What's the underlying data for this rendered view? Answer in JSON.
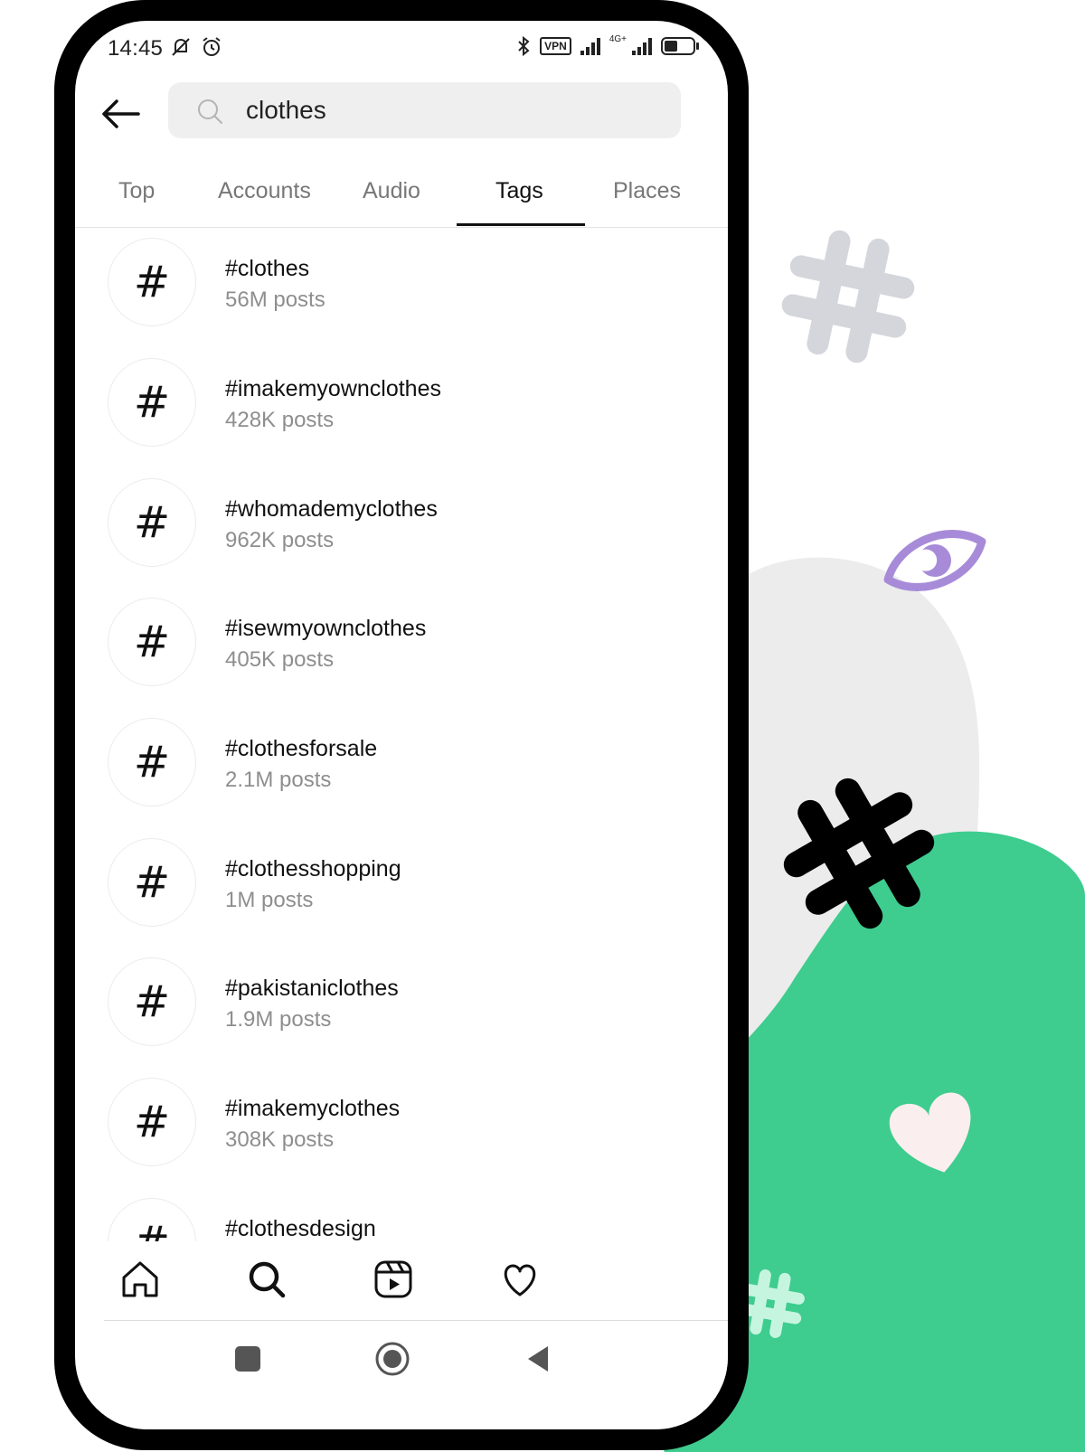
{
  "statusbar": {
    "time": "14:45",
    "icons": [
      "mute-icon",
      "alarm-icon",
      "bluetooth-icon",
      "vpn-icon",
      "signal-icon",
      "signal-4g-icon",
      "battery-icon"
    ],
    "vpn": "VPN",
    "network": "4G+"
  },
  "search": {
    "query": "clothes",
    "back_icon": "back-arrow-icon",
    "search_icon": "search-icon"
  },
  "tabs": [
    {
      "label": "Top",
      "active": false
    },
    {
      "label": "Accounts",
      "active": false
    },
    {
      "label": "Audio",
      "active": false
    },
    {
      "label": "Tags",
      "active": true
    },
    {
      "label": "Places",
      "active": false
    }
  ],
  "tag_symbol": "#",
  "results": [
    {
      "name": "#clothes",
      "count": "56M posts"
    },
    {
      "name": "#imakemyownclothes",
      "count": "428K posts"
    },
    {
      "name": "#whomademyclothes",
      "count": "962K posts"
    },
    {
      "name": "#isewmyownclothes",
      "count": "405K posts"
    },
    {
      "name": "#clothesforsale",
      "count": "2.1M posts"
    },
    {
      "name": "#clothesshopping",
      "count": "1M posts"
    },
    {
      "name": "#pakistaniclothes",
      "count": "1.9M posts"
    },
    {
      "name": "#imakemyclothes",
      "count": "308K posts"
    },
    {
      "name": "#clothesdesign",
      "count": ""
    }
  ],
  "bottom_nav": [
    "home-icon",
    "search-icon",
    "reels-icon",
    "heart-icon"
  ],
  "system_nav": [
    "recents-button",
    "home-button",
    "back-button"
  ],
  "colors": {
    "accent_green": "#3ecc8f",
    "blob_gray": "#ececec",
    "hashtag_gray": "#d4d6dc",
    "eye_purple": "#a78bd8",
    "heart_pink": "#fbeeee",
    "hashtag_mint": "#c6f5df",
    "tab_inactive": "#777777",
    "muted_text": "#8e8e8e"
  }
}
